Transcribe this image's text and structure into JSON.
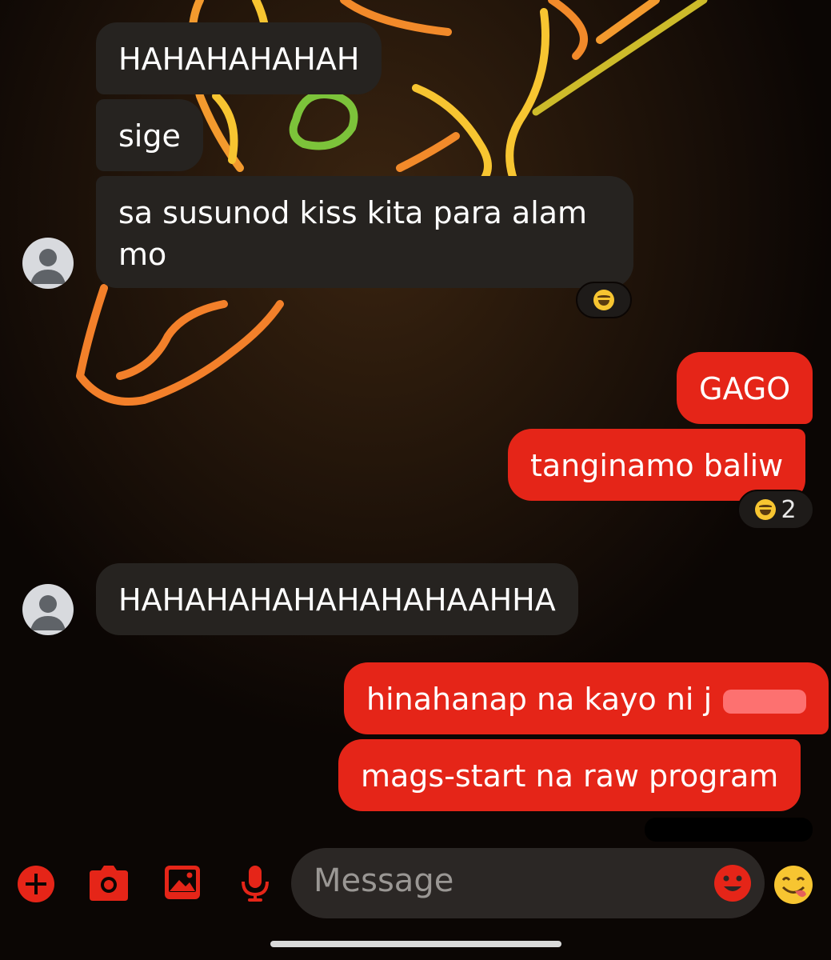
{
  "conversation": {
    "received_group_1": [
      {
        "text": "HAHAHAHAHAH"
      },
      {
        "text": "sige"
      },
      {
        "text": "sa susunod kiss kita para alam mo",
        "reaction": {
          "emoji": "laughing-face"
        }
      }
    ],
    "sent_group_1": [
      {
        "text": "GAGO"
      },
      {
        "text": "tanginamo baliw",
        "reaction": {
          "emoji": "laughing-face",
          "count": "2"
        }
      }
    ],
    "received_group_2": [
      {
        "text": "HAHAHAHAHAHAHAHAAHHA"
      }
    ],
    "sent_group_2": [
      {
        "text": "hinahanap na kayo ni j"
      },
      {
        "text": "mags-start na raw program"
      }
    ]
  },
  "composer": {
    "placeholder": "Message",
    "icons": [
      "plus-icon",
      "camera-icon",
      "gallery-icon",
      "microphone-icon",
      "emoji-icon",
      "quick-reaction-emoji-icon"
    ]
  },
  "colors": {
    "sent_bubble": "#e52518",
    "received_bubble": "#262320",
    "accent": "#e52518",
    "background": "#0b0604"
  }
}
